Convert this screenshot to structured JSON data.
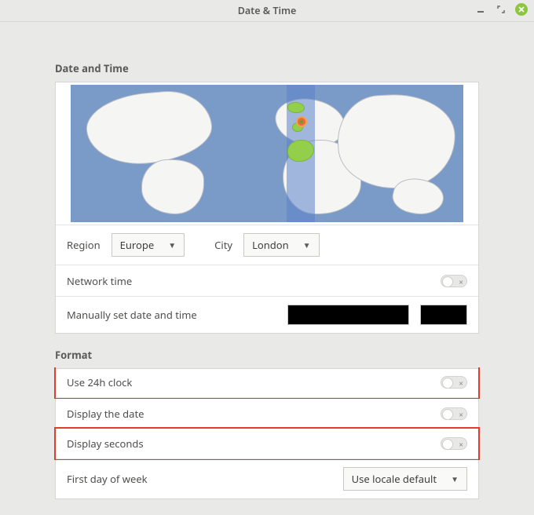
{
  "window": {
    "title": "Date & Time"
  },
  "sections": {
    "datetime_heading": "Date and Time",
    "format_heading": "Format"
  },
  "datetime": {
    "region_label": "Region",
    "region_value": "Europe",
    "city_label": "City",
    "city_value": "London",
    "network_time_label": "Network time",
    "network_time_on": false,
    "manual_set_label": "Manually set date and time"
  },
  "format": {
    "use_24h_label": "Use 24h clock",
    "use_24h_on": false,
    "display_date_label": "Display the date",
    "display_date_on": false,
    "display_seconds_label": "Display seconds",
    "display_seconds_on": false,
    "first_day_label": "First day of week",
    "first_day_value": "Use locale default"
  }
}
